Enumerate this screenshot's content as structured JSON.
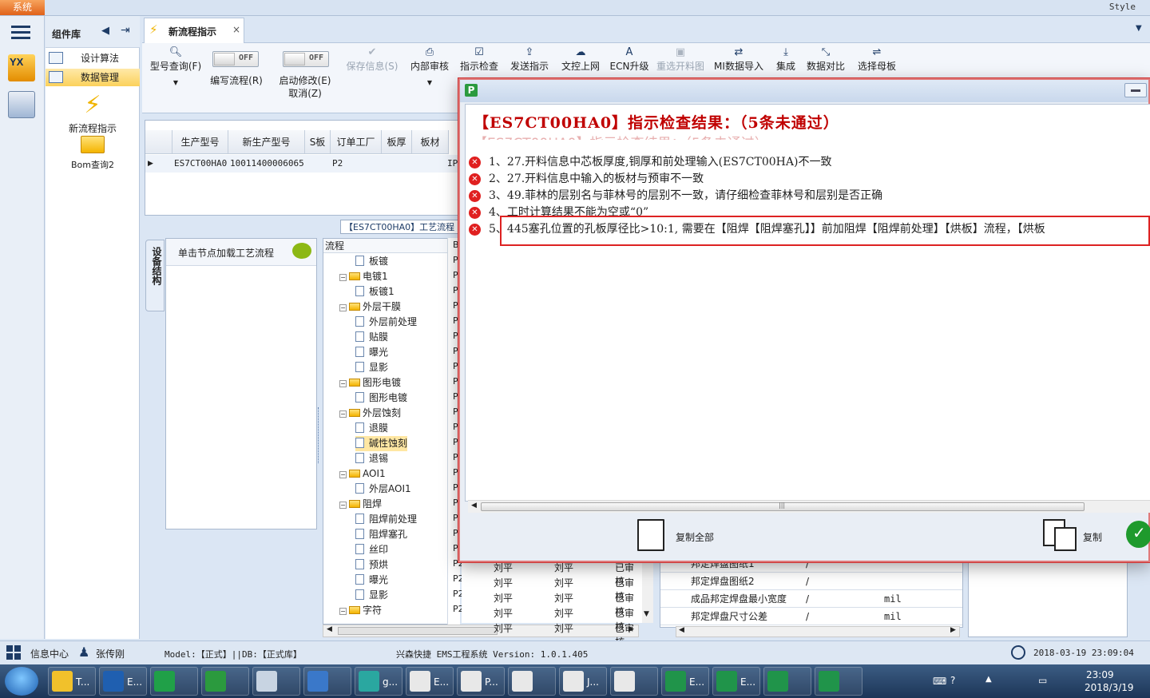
{
  "app": {
    "system_tab": "系统",
    "style_label": "Style"
  },
  "component_library": {
    "title": "组件库",
    "items": [
      {
        "label": "设计算法"
      },
      {
        "label": "数据管理"
      }
    ],
    "big_items": [
      {
        "label": "新流程指示"
      },
      {
        "label": "Bom查询2"
      }
    ]
  },
  "doc_tab": {
    "label": "新流程指示",
    "close": "×"
  },
  "ribbon": {
    "model_query": "型号查询(F)",
    "edit_flow": "编写流程(R)",
    "start_modify": "启动修改(E)",
    "cancel": "取消(Z)",
    "toggle_off": "OFF",
    "save_info": "保存信息(S)",
    "internal_review": "内部审核",
    "instruction_check": "指示检查",
    "send_instruction": "发送指示",
    "doc_online": "文控上网",
    "ecn_upgrade": "ECN升级",
    "reselect_cut": "重选开料图",
    "mi_import": "MI数据导入",
    "integrate": "集成",
    "data_compare": "数据对比",
    "select_mother": "选择母板"
  },
  "grid": {
    "headers": [
      "生产型号",
      "新生产型号",
      "S板",
      "订单工厂",
      "板厚",
      "板材"
    ],
    "row": [
      "ES7CT00HA0",
      "10011400006065",
      "P2",
      "",
      "",
      "",
      "IP"
    ]
  },
  "process": {
    "title": "【ES7CT00HA0】工艺流程",
    "side_tab": "设备结构",
    "left_head": "单击节点加载工艺流程",
    "tree_header": "流程",
    "b_header": "B",
    "tree": [
      {
        "label": "板镀",
        "level": 2,
        "b": "P"
      },
      {
        "label": "电镀1",
        "level": 1,
        "b": "P"
      },
      {
        "label": "板镀1",
        "level": 2,
        "b": "P"
      },
      {
        "label": "外层干膜",
        "level": 1,
        "b": "P"
      },
      {
        "label": "外层前处理",
        "level": 2,
        "b": "P"
      },
      {
        "label": "贴膜",
        "level": 2,
        "b": "P"
      },
      {
        "label": "曝光",
        "level": 2,
        "b": "P"
      },
      {
        "label": "显影",
        "level": 2,
        "b": "P"
      },
      {
        "label": "图形电镀",
        "level": 1,
        "b": "P"
      },
      {
        "label": "图形电镀",
        "level": 2,
        "b": "P"
      },
      {
        "label": "外层蚀刻",
        "level": 1,
        "b": "P"
      },
      {
        "label": "退膜",
        "level": 2,
        "b": "P"
      },
      {
        "label": "碱性蚀刻",
        "level": 2,
        "b": "P",
        "selected": true
      },
      {
        "label": "退锡",
        "level": 2,
        "b": "P"
      },
      {
        "label": "AOI1",
        "level": 1,
        "b": "P"
      },
      {
        "label": "外层AOI1",
        "level": 2,
        "b": "P"
      },
      {
        "label": "阻焊",
        "level": 1,
        "b": "P"
      },
      {
        "label": "阻焊前处理",
        "level": 2,
        "b": "P"
      },
      {
        "label": "阻焊塞孔",
        "level": 2,
        "b": "P"
      },
      {
        "label": "丝印",
        "level": 2,
        "b": "P"
      },
      {
        "label": "预烘",
        "level": 2,
        "b": "P2"
      },
      {
        "label": "曝光",
        "level": 2,
        "b": "P2"
      },
      {
        "label": "显影",
        "level": 2,
        "b": "P2"
      },
      {
        "label": "字符",
        "level": 1,
        "b": "P2"
      }
    ]
  },
  "review_rows": [
    {
      "a": "刘平",
      "b": "刘平",
      "c": "已审核"
    },
    {
      "a": "刘平",
      "b": "刘平",
      "c": "已审核"
    },
    {
      "a": "刘平",
      "b": "刘平",
      "c": "已审核"
    },
    {
      "a": "刘平",
      "b": "刘平",
      "c": "已审核"
    },
    {
      "a": "刘平",
      "b": "刘平",
      "c": "已审核"
    }
  ],
  "prop_rows": [
    {
      "name": "邦定焊盘图纸1",
      "v": "/",
      "u": ""
    },
    {
      "name": "邦定焊盘图纸2",
      "v": "/",
      "u": ""
    },
    {
      "name": "成品邦定焊盘最小宽度",
      "v": "/",
      "u": "mil"
    },
    {
      "name": "邦定焊盘尺寸公差",
      "v": "/",
      "u": "mil"
    }
  ],
  "dialog": {
    "heading": "【ES7CT00HA0】指示检查结果：（5条未通过）",
    "ghost": "【ES7CT00HA0】指示检查结果：（5条未通过）",
    "errors": [
      "1、27.开料信息中芯板厚度,铜厚和前处理输入(ES7CT00HA)不一致",
      "2、27.开料信息中输入的板材与预审不一致",
      "3、49.菲林的层别名与菲林号的层别不一致，请仔细检查菲林号和层别是否正确",
      "4、工时计算结果不能为空或“0”",
      "5、445塞孔位置的孔板厚径比>10:1, 需要在【阻焊【阻焊塞孔】】前加阻焊【阻焊前处理】【烘板】流程，【烘板"
    ],
    "copy_all": "复制全部",
    "copy": "复制"
  },
  "status": {
    "info_center": "信息中心",
    "user": "张传刚",
    "model": "Model:【正式】||DB:【正式库】",
    "product": "兴森快捷 EMS工程系统 Version: 1.0.1.405",
    "datetime": "2018-03-19 23:09:04"
  },
  "taskbar": {
    "items": [
      {
        "label": "T..."
      },
      {
        "label": "E..."
      },
      {
        "label": ""
      },
      {
        "label": ""
      },
      {
        "label": ""
      },
      {
        "label": ""
      },
      {
        "label": "g..."
      },
      {
        "label": "E..."
      },
      {
        "label": "P..."
      },
      {
        "label": ""
      },
      {
        "label": "J..."
      },
      {
        "label": ""
      },
      {
        "label": "E..."
      },
      {
        "label": "E..."
      },
      {
        "label": ""
      },
      {
        "label": ""
      }
    ],
    "time": "23:09",
    "date": "2018/3/19"
  },
  "colors": {
    "error_red": "#c00000",
    "accent_blue": "#1d3b66",
    "highlight": "#ffe7a3"
  }
}
